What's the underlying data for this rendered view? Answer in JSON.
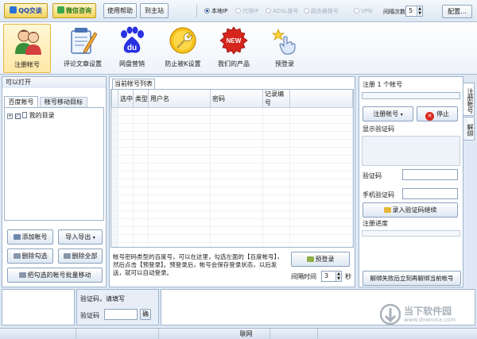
{
  "toolbar": {
    "qq_label": "QQ交谈",
    "service_label": "微信咨询",
    "help_label": "使用帮助",
    "site_label": "到主站",
    "net_options": [
      "本地IP",
      "代理IP",
      "ADSL拨号",
      "路由器拨号",
      "VPN"
    ],
    "selected_net": "本地IP",
    "interval_label": "间隔次数",
    "interval_value": "5",
    "config_label": "配置..."
  },
  "ribbon": {
    "items": [
      {
        "label": "注册帐号",
        "icon": "users-icon"
      },
      {
        "label": "评论文章设置",
        "icon": "notepad-pen-icon"
      },
      {
        "label": "网盘营销",
        "icon": "baidu-du-icon"
      },
      {
        "label": "防止被K设置",
        "icon": "wrench-icon"
      },
      {
        "label": "我们的产品",
        "icon": "new-badge-icon"
      },
      {
        "label": "预登录",
        "icon": "hand-star-icon"
      }
    ],
    "du_text": "du",
    "new_text": "NEW"
  },
  "left": {
    "title": "可以打开",
    "tabs": [
      "百度帐号",
      "帐号移动目标"
    ],
    "tree_root": "我的目录",
    "tree_expander": "+",
    "add_label": "添加帐号",
    "import_label": "导入导出",
    "delete_checked_label": "删除勾选",
    "delete_all_label": "删除全部",
    "move_label": "把勾选的帐号批量移动"
  },
  "center": {
    "tab_label": "当前帐号列表",
    "columns": [
      "选中",
      "类型",
      "用户名",
      "密码",
      "记录编号"
    ],
    "description": "帐号密码类型的百度号，可以在这里，勾选左面的【百度帐号】，然后点击【预登录】。预登录后，帐号会保存登录状态，以后发送，就可以自动登录。",
    "prelogin_label": "预登录",
    "interval_label": "间隔时间",
    "interval_value": "3",
    "interval_unit": "秒"
  },
  "right": {
    "register_header": "注册 1 个帐号",
    "register_btn": "注册帐号",
    "stop_btn": "停止",
    "show_captcha_label": "显示验证码",
    "captcha_label": "验证码",
    "phone_label": "手机验证码",
    "submit_label": "录入验证码继续",
    "progress_label": "注册进度",
    "unbind_label": "解绑失败后立刻再解绑当前帐号",
    "vtabs": [
      "注册帐号",
      "解绑"
    ]
  },
  "bottom": {
    "prompt": "验证码，请填写",
    "captcha_label": "验证码",
    "confirm_label": "确"
  },
  "status": {
    "network": "联网"
  },
  "watermark": {
    "name": "当下软件园",
    "url": "www.downxia.com"
  }
}
